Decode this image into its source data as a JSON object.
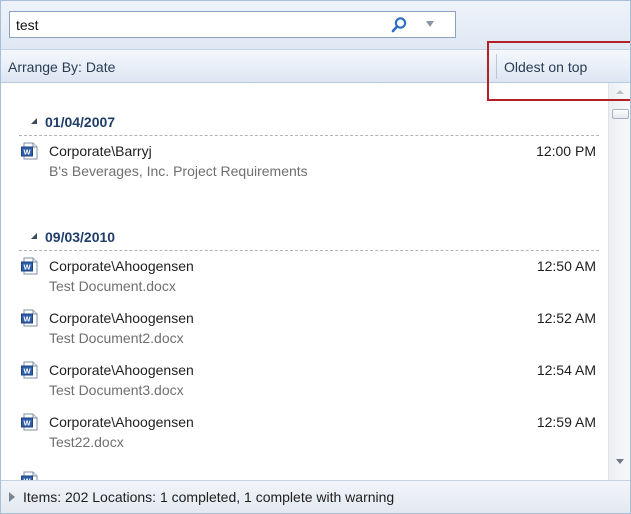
{
  "search": {
    "value": "test"
  },
  "arrange": {
    "label": "Arrange By: Date",
    "sort_order": "Oldest on top"
  },
  "groups": [
    {
      "date": "01/04/2007",
      "items": [
        {
          "author": "Corporate\\Barryj",
          "time": "12:00 PM",
          "title": "B's Beverages, Inc. Project Requirements",
          "icon": "word-document-icon"
        }
      ]
    },
    {
      "date": "09/03/2010",
      "items": [
        {
          "author": "Corporate\\Ahoogensen",
          "time": "12:50 AM",
          "title": "Test Document.docx",
          "icon": "word-document-icon"
        },
        {
          "author": "Corporate\\Ahoogensen",
          "time": "12:52 AM",
          "title": "Test Document2.docx",
          "icon": "word-document-icon"
        },
        {
          "author": "Corporate\\Ahoogensen",
          "time": "12:54 AM",
          "title": "Test Document3.docx",
          "icon": "word-document-icon"
        },
        {
          "author": "Corporate\\Ahoogensen",
          "time": "12:59 AM",
          "title": "Test22.docx",
          "icon": "word-document-icon"
        }
      ]
    }
  ],
  "status": {
    "text": "Items: 202  Locations: 1 completed, 1 complete with warning"
  },
  "colors": {
    "highlight": "#b32026",
    "group_header": "#1f3d6a",
    "subtitle": "#6f6f6f"
  }
}
